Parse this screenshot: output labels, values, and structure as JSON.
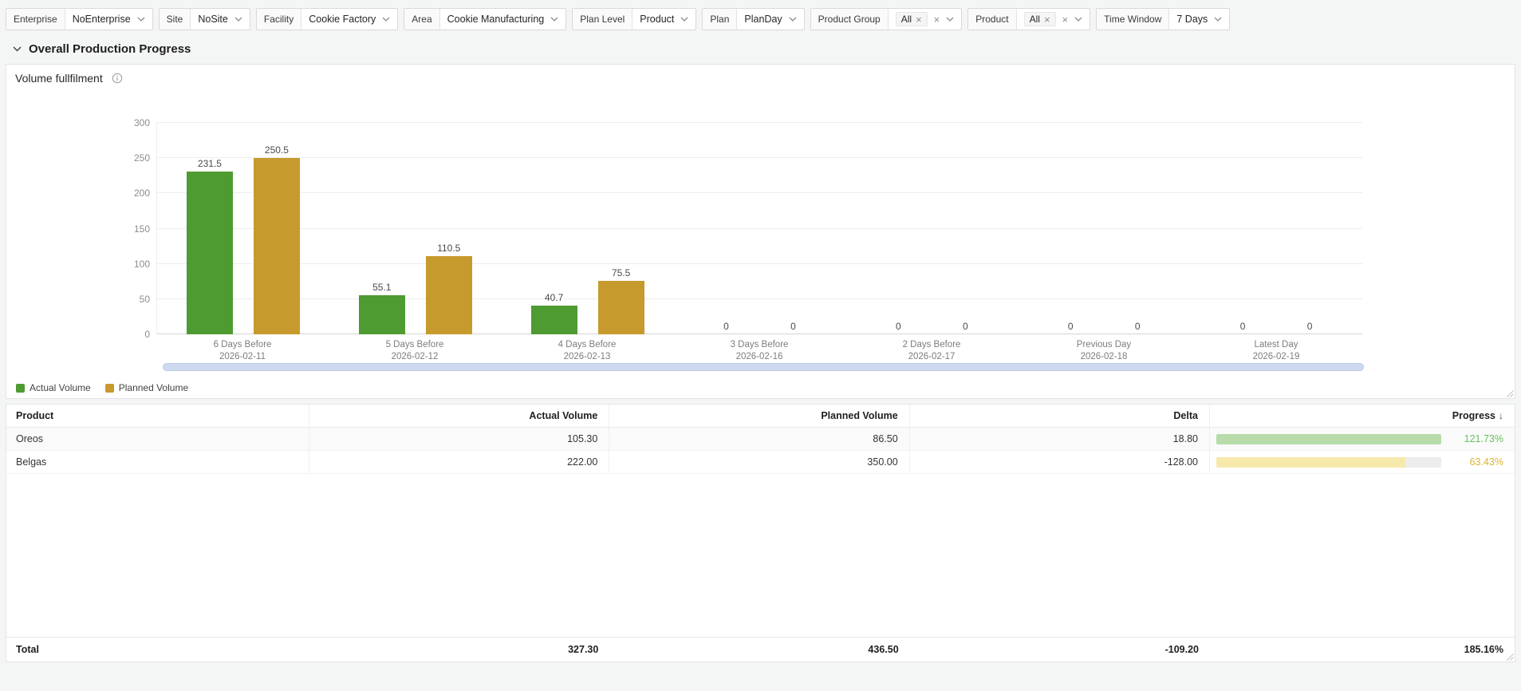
{
  "toolbar": {
    "filters": [
      {
        "id": "enterprise",
        "label": "Enterprise",
        "value": "NoEnterprise",
        "type": "select"
      },
      {
        "id": "site",
        "label": "Site",
        "value": "NoSite",
        "type": "select"
      },
      {
        "id": "facility",
        "label": "Facility",
        "value": "Cookie Factory",
        "type": "select"
      },
      {
        "id": "area",
        "label": "Area",
        "value": "Cookie Manufacturing",
        "type": "select"
      },
      {
        "id": "plan-level",
        "label": "Plan Level",
        "value": "Product",
        "type": "select"
      },
      {
        "id": "plan",
        "label": "Plan",
        "value": "PlanDay",
        "type": "select"
      },
      {
        "id": "product-group",
        "label": "Product Group",
        "value": "All",
        "type": "multiselect"
      },
      {
        "id": "product",
        "label": "Product",
        "value": "All",
        "type": "multiselect"
      },
      {
        "id": "time-window",
        "label": "Time Window",
        "value": "7 Days",
        "type": "select"
      }
    ]
  },
  "section": {
    "title": "Overall Production Progress"
  },
  "chart_panel": {
    "title": "Volume fullfilment"
  },
  "chart_data": {
    "type": "bar",
    "title": "Volume fullfilment",
    "categories": [
      "6 Days Before",
      "5 Days Before",
      "4 Days Before",
      "3 Days Before",
      "2 Days Before",
      "Previous Day",
      "Latest Day"
    ],
    "category_dates": [
      "2026-02-11",
      "2026-02-12",
      "2026-02-13",
      "2026-02-16",
      "2026-02-17",
      "2026-02-18",
      "2026-02-19"
    ],
    "series": [
      {
        "name": "Actual Volume",
        "color": "#4e9b31",
        "values": [
          231.5,
          55.1,
          40.7,
          0,
          0,
          0,
          0
        ]
      },
      {
        "name": "Planned Volume",
        "color": "#c79a2e",
        "values": [
          250.5,
          110.5,
          75.5,
          0,
          0,
          0,
          0
        ]
      }
    ],
    "ylim": [
      0,
      300
    ],
    "yticks": [
      0,
      50,
      100,
      150,
      200,
      250,
      300
    ],
    "grid": true,
    "legend_position": "bottom-left",
    "value_labels": true
  },
  "table": {
    "columns": [
      {
        "label": "Product",
        "align": "left"
      },
      {
        "label": "Actual Volume",
        "align": "right"
      },
      {
        "label": "Planned Volume",
        "align": "right"
      },
      {
        "label": "Delta",
        "align": "right"
      },
      {
        "label": "Progress",
        "align": "right",
        "sort": "desc",
        "sort_icon": "↓"
      }
    ],
    "rows": [
      {
        "product": "Oreos",
        "actual": "105.30",
        "planned": "86.50",
        "delta": "18.80",
        "progress": "121.73%",
        "bar_fill_pct": 100,
        "status": "green"
      },
      {
        "product": "Belgas",
        "actual": "222.00",
        "planned": "350.00",
        "delta": "-128.00",
        "progress": "63.43%",
        "bar_fill_pct": 84,
        "status": "yellow"
      }
    ],
    "total": {
      "label": "Total",
      "actual": "327.30",
      "planned": "436.50",
      "delta": "-109.20",
      "progress": "185.16%"
    }
  },
  "colors": {
    "progress_green_fill": "#b7dcaa",
    "progress_green_text": "#67bf5c",
    "progress_yellow_fill": "#f7e9ab",
    "progress_yellow_text": "#d9b530",
    "scrollbar": "#cfd9ef"
  }
}
